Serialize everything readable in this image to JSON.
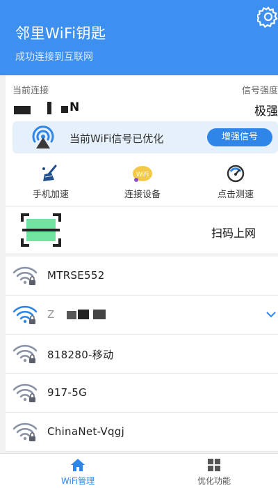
{
  "header": {
    "title": "邻里WiFi钥匙",
    "subtitle": "成功连接到互联网",
    "settings_icon": "gear-icon"
  },
  "connection": {
    "current_label": "当前连接",
    "signal_label": "信号强度",
    "ssid_visible": "N",
    "signal_value": "极强",
    "banner": {
      "text": "当前WiFi信号已优化",
      "button_label": "增强信号",
      "icon": "signal-tower-icon"
    },
    "tools": [
      {
        "label": "手机加速",
        "icon": "broom-speedup-icon"
      },
      {
        "label": "连接设备",
        "icon": "wifi-devices-icon"
      },
      {
        "label": "点击测速",
        "icon": "speedometer-icon"
      }
    ]
  },
  "scan": {
    "label": "扫码上网",
    "icon": "qr-scan-icon"
  },
  "wifi_list": [
    {
      "name": "MTRSE552",
      "locked": true
    },
    {
      "name": "Z",
      "locked": true,
      "expanded": true
    },
    {
      "name": "818280-移动",
      "locked": true
    },
    {
      "name": "917-5G",
      "locked": true
    },
    {
      "name": "ChinaNet-Vqgj",
      "locked": true
    }
  ],
  "bottom_nav": [
    {
      "label": "WiFi管理",
      "icon": "home-icon",
      "active": true
    },
    {
      "label": "优化功能",
      "icon": "grid-icon",
      "active": false
    }
  ],
  "colors": {
    "primary": "#3d8ff0",
    "accent": "#2f86e8",
    "scan_green": "#6fe3a0"
  }
}
